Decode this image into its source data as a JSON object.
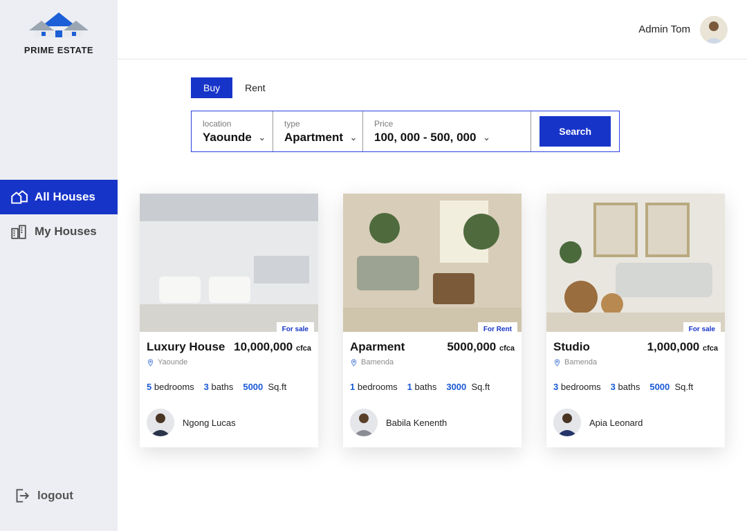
{
  "brand": "PRIME ESTATE",
  "user": {
    "name": "Admin Tom"
  },
  "nav": {
    "all_houses": "All Houses",
    "my_houses": "My Houses",
    "logout": "logout"
  },
  "tabs": {
    "buy": "Buy",
    "rent": "Rent"
  },
  "filter": {
    "location_label": "location",
    "location_value": "Yaounde",
    "type_label": "type",
    "type_value": "Apartment",
    "price_label": "Price",
    "price_value": "100, 000 - 500, 000",
    "search": "Search"
  },
  "listings": [
    {
      "badge": "For sale",
      "title": "Luxury House",
      "price": "10,000,000",
      "currency": "cfca",
      "location": "Yaounde",
      "bedrooms": "5",
      "baths": "3",
      "sqft": "5000",
      "owner": "Ngong Lucas"
    },
    {
      "badge": "For Rent",
      "title": "Aparment",
      "price": "5000,000",
      "currency": "cfca",
      "location": "Bamenda",
      "bedrooms": "1",
      "baths": "1",
      "sqft": "3000",
      "owner": "Babila Kenenth"
    },
    {
      "badge": "For sale",
      "title": "Studio",
      "price": "1,000,000",
      "currency": "cfca",
      "location": "Bamenda",
      "bedrooms": "3",
      "baths": "3",
      "sqft": "5000",
      "owner": "Apia Leonard"
    }
  ],
  "labels": {
    "bedrooms": "bedrooms",
    "baths": "baths",
    "sqft": "Sq.ft"
  }
}
